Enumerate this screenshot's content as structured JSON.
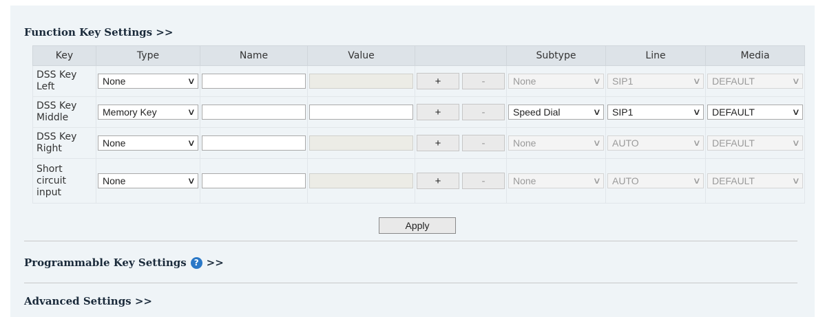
{
  "sections": {
    "function_key": "Function Key Settings >>",
    "programmable_key": "Programmable Key Settings",
    "programmable_suffix": ">>",
    "advanced": "Advanced Settings >>"
  },
  "table": {
    "headers": {
      "key": "Key",
      "type": "Type",
      "name": "Name",
      "value": "Value",
      "actions": "",
      "subtype": "Subtype",
      "line": "Line",
      "media": "Media"
    },
    "rows": [
      {
        "key_line1": "DSS Key",
        "key_line2": "Left",
        "key_line3": "",
        "type": "None",
        "name": "",
        "value": "",
        "plus": "+",
        "minus": "-",
        "subtype": "None",
        "line": "SIP1",
        "media": "DEFAULT"
      },
      {
        "key_line1": "DSS Key",
        "key_line2": "Middle",
        "key_line3": "",
        "type": "Memory Key",
        "name": "",
        "value": "",
        "plus": "+",
        "minus": "-",
        "subtype": "Speed Dial",
        "line": "SIP1",
        "media": "DEFAULT"
      },
      {
        "key_line1": "DSS Key",
        "key_line2": "Right",
        "key_line3": "",
        "type": "None",
        "name": "",
        "value": "",
        "plus": "+",
        "minus": "-",
        "subtype": "None",
        "line": "AUTO",
        "media": "DEFAULT"
      },
      {
        "key_line1": "Short",
        "key_line2": "circuit",
        "key_line3": "input",
        "type": "None",
        "name": "",
        "value": "",
        "plus": "+",
        "minus": "-",
        "subtype": "None",
        "line": "AUTO",
        "media": "DEFAULT"
      }
    ]
  },
  "apply_label": "Apply",
  "icons": {
    "help": "question-circle-icon",
    "dropdown": "chevron-down-icon"
  },
  "colors": {
    "panel_bg": "#eff4f7",
    "header_bg": "#dde3e8",
    "help_icon": "#2a78c7"
  }
}
